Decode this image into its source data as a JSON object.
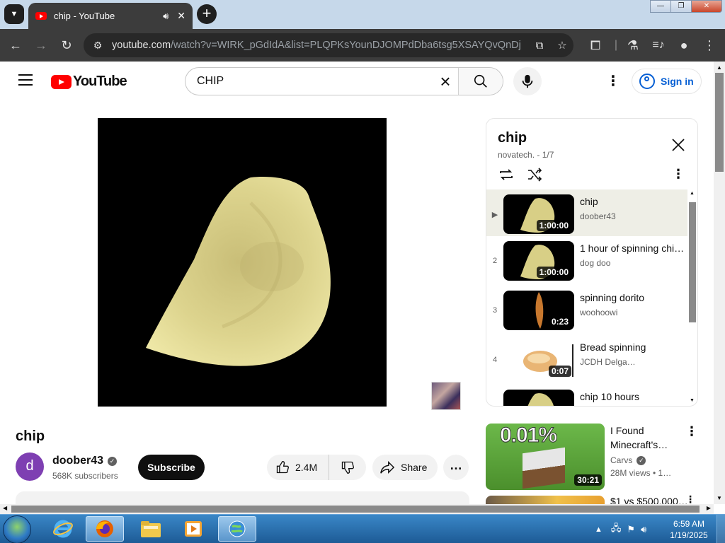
{
  "browser": {
    "tab_title": "chip - YouTube",
    "url_host": "youtube.com",
    "url_rest": "/watch?v=WIRK_pGdIdA&list=PLQPKsYounDJOMPdDba6tsg5XSAYQvQnDj",
    "window_minimize": "—",
    "window_restore": "❐",
    "window_close": "✕"
  },
  "youtube": {
    "logo_text": "YouTube",
    "search_value": "CHIP",
    "sign_in": "Sign in"
  },
  "video": {
    "title": "chip",
    "channel_initial": "d",
    "channel_name": "doober43",
    "subscribers": "568K subscribers",
    "subscribe_label": "Subscribe",
    "likes": "2.4M",
    "share_label": "Share"
  },
  "playlist": {
    "title": "chip",
    "subtitle": "novatech. - 1/7",
    "items": [
      {
        "index": "▶",
        "title": "chip",
        "channel": "doober43",
        "duration": "1:00:00",
        "thumb": "chip"
      },
      {
        "index": "2",
        "title": "1 hour of spinning chi…",
        "channel": "dog doo",
        "duration": "1:00:00",
        "thumb": "chip"
      },
      {
        "index": "3",
        "title": "spinning dorito",
        "channel": "woohoowi",
        "duration": "0:23",
        "thumb": "dorito"
      },
      {
        "index": "4",
        "title": "Bread spinning",
        "channel": "JCDH Delga…",
        "duration": "0:07",
        "thumb": "bread"
      },
      {
        "index": "5",
        "title": "chip 10 hours",
        "channel": "",
        "duration": "",
        "thumb": "chip"
      }
    ]
  },
  "recommendations": [
    {
      "thumb_text": "0.01%",
      "title": "I Found Minecraft's…",
      "channel": "Carvs",
      "views": "28M views • 1…",
      "duration": "30:21"
    },
    {
      "title": "$1 vs $500,000…"
    }
  ],
  "taskbar": {
    "time": "6:59 AM",
    "date": "1/19/2025"
  },
  "colors": {
    "youtube_red": "#ff0000",
    "link_blue": "#065fd4",
    "chip": "#d8cf86"
  }
}
